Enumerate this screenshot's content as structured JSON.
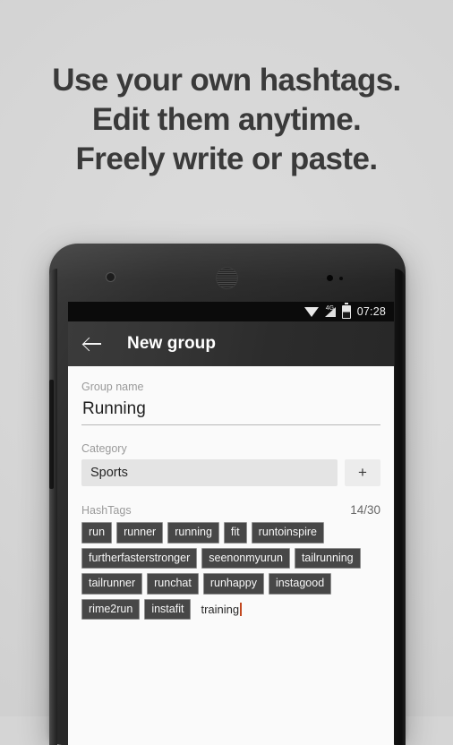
{
  "promo": {
    "headline_lines": [
      "Use your own hashtags.",
      "Edit them anytime.",
      "Freely write or paste."
    ],
    "background_color": "#d5d5d5",
    "text_color": "#3a3a3a"
  },
  "device": {
    "icons": {
      "front_camera": "camera-icon",
      "earpiece": "speaker-grille-icon",
      "sensors": "proximity-sensor-icon",
      "volume_button": "volume-rocker"
    }
  },
  "screen": {
    "status_bar": {
      "clock": "07:28",
      "wifi_icon": "wifi-icon",
      "network_label": "4G",
      "signal_icon": "cellular-signal-icon",
      "battery_icon": "battery-icon",
      "background_color": "#0b0b0b"
    },
    "app_bar": {
      "back_icon": "back-arrow-icon",
      "title": "New group",
      "background_color": "#2e2e2e"
    },
    "form": {
      "group_name": {
        "label": "Group name",
        "value": "Running",
        "placeholder": "Group name"
      },
      "category": {
        "label": "Category",
        "value": "Sports",
        "add_button_label": "+"
      },
      "hashtags": {
        "label": "HashTags",
        "counter": "14/30",
        "chips": [
          "run",
          "runner",
          "running",
          "fit",
          "runtoinspire",
          "furtherfasterstronger",
          "seenonmyurun",
          "tailrunning",
          "tailrunner",
          "runchat",
          "runhappy",
          "instagood",
          "rime2run",
          "instafit"
        ],
        "draft_text": "training",
        "cursor_color": "#c2481f",
        "chip_background": "#474747",
        "chip_text_color": "#f7f7f7"
      }
    }
  }
}
